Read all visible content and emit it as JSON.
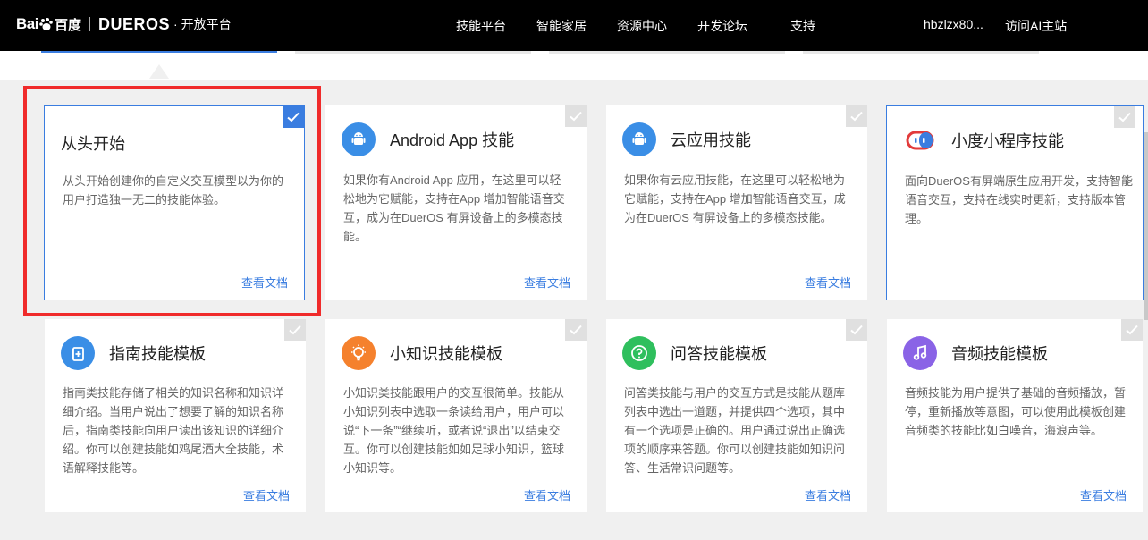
{
  "header": {
    "brand_bai": "Bai",
    "brand_du": "百度",
    "brand_dueros": "DUEROS",
    "brand_dot": "·",
    "brand_platform": "开放平台",
    "nav": [
      "技能平台",
      "智能家居",
      "资源中心",
      "开发论坛",
      "支持"
    ],
    "user": "hbzlzx80...",
    "visit_ai": "访问AI主站"
  },
  "colors": {
    "accent": "#3a7de0",
    "highlight": "#f02b2b",
    "orange": "#f5812d",
    "green": "#2fbf5d",
    "purple": "#8a63e6"
  },
  "cards": [
    {
      "title": "从头开始",
      "desc": "从头开始创建你的自定义交互模型以为你的用户打造独一无二的技能体验。",
      "doc": "查看文档",
      "icon": "none",
      "checked": true
    },
    {
      "title": "Android App 技能",
      "desc": "如果你有Android App 应用，在这里可以轻松地为它赋能，支持在App 增加智能语音交互，成为在DuerOS 有屏设备上的多模态技能。",
      "doc": "查看文档",
      "icon": "android-icon",
      "checked": false
    },
    {
      "title": "云应用技能",
      "desc": "如果你有云应用技能，在这里可以轻松地为它赋能，支持在App 增加智能语音交互，成为在DuerOS 有屏设备上的多模态技能。",
      "doc": "查看文档",
      "icon": "android-icon",
      "checked": false
    },
    {
      "title": "小度小程序技能",
      "desc": "面向DuerOS有屏端原生应用开发，支持智能语音交互，支持在线实时更新，支持版本管理。",
      "doc": "",
      "icon": "mini-program-icon",
      "checked": false
    },
    {
      "title": "指南技能模板",
      "desc": "指南类技能存储了相关的知识名称和知识详细介绍。当用户说出了想要了解的知识名称后，指南类技能向用户读出该知识的详细介绍。你可以创建技能如鸡尾酒大全技能，术语解释技能等。",
      "doc": "查看文档",
      "icon": "guide-icon",
      "checked": false
    },
    {
      "title": "小知识技能模板",
      "desc": "小知识类技能跟用户的交互很简单。技能从小知识列表中选取一条读给用户，用户可以说“下一条”“继续听，或者说“退出”以结束交互。你可以创建技能如如足球小知识，篮球小知识等。",
      "doc": "查看文档",
      "icon": "lightbulb-icon",
      "checked": false
    },
    {
      "title": "问答技能模板",
      "desc": "问答类技能与用户的交互方式是技能从题库列表中选出一道题，并提供四个选项，其中有一个选项是正确的。用户通过说出正确选项的顺序来答题。你可以创建技能如知识问答、生活常识问题等。",
      "doc": "查看文档",
      "icon": "question-icon",
      "checked": false
    },
    {
      "title": "音频技能模板",
      "desc": "音频技能为用户提供了基础的音频播放，暂停，重新播放等意图，可以使用此模板创建音频类的技能比如白噪音，海浪声等。",
      "doc": "查看文档",
      "icon": "music-icon",
      "checked": false
    }
  ]
}
